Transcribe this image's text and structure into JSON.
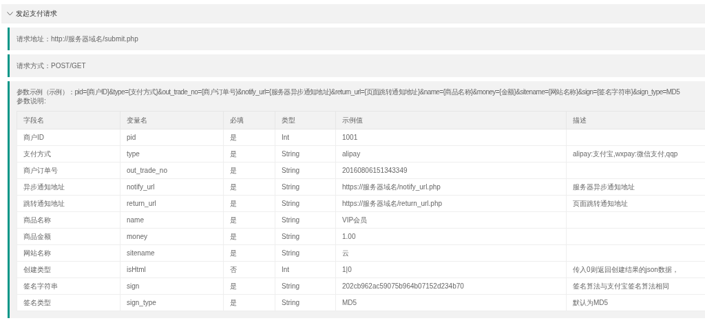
{
  "panel": {
    "title": "发起支付请求",
    "expanded": true
  },
  "blocks": [
    {
      "kind": "text",
      "text": "请求地址：http://服务器域名/submit.php"
    },
    {
      "kind": "text",
      "text": "请求方式：POST/GET"
    }
  ],
  "params": {
    "example": "参数示例（示例）：pid={商户ID}&type={支付方式}&out_trade_no={商户订单号}&notify_url={服务器异步通知地址}&return_url={页面跳转通知地址}&name={商品名称}&money={金额}&sitename={网站名称}&sign={签名字符串}&sign_type=MD5",
    "note": "参数说明:",
    "table": {
      "columns": [
        "字段名",
        "变量名",
        "必填",
        "类型",
        "示例值",
        "描述"
      ],
      "rows": [
        [
          "商户ID",
          "pid",
          "是",
          "Int",
          "1001",
          ""
        ],
        [
          "支付方式",
          "type",
          "是",
          "String",
          "alipay",
          "alipay:支付宝,wxpay:微信支付,qqp"
        ],
        [
          "商户订单号",
          "out_trade_no",
          "是",
          "String",
          "20160806151343349",
          ""
        ],
        [
          "异步通知地址",
          "notify_url",
          "是",
          "String",
          "https://服务器域名/notify_url.php",
          "服务器异步通知地址"
        ],
        [
          "跳转通知地址",
          "return_url",
          "是",
          "String",
          "https://服务器域名/return_url.php",
          "页面跳转通知地址"
        ],
        [
          "商品名称",
          "name",
          "是",
          "String",
          "VIP会员",
          ""
        ],
        [
          "商品金额",
          "money",
          "是",
          "String",
          "1.00",
          ""
        ],
        [
          "网站名称",
          "sitename",
          "是",
          "String",
          "云",
          ""
        ],
        [
          "创建类型",
          "isHtml",
          "否",
          "Int",
          "1|0",
          "传入0则返回创建结果的json数据，"
        ],
        [
          "签名字符串",
          "sign",
          "是",
          "String",
          "202cb962ac59075b964b07152d234b70",
          "签名算法与支付宝签名算法相同"
        ],
        [
          "签名类型",
          "sign_type",
          "是",
          "String",
          "MD5",
          "默认为MD5"
        ]
      ]
    }
  }
}
